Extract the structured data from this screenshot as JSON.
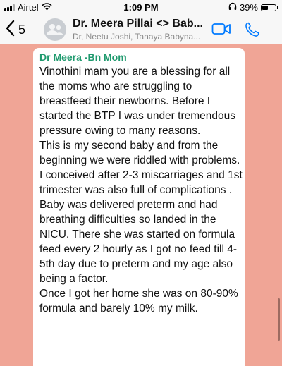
{
  "status": {
    "carrier": "Airtel",
    "time": "1:09 PM",
    "battery": "39%",
    "battery_level": 0.39
  },
  "header": {
    "back_count": "5",
    "title": "Dr. Meera Pillai <> Bab...",
    "subtitle": "Dr, Neetu Joshi, Tanaya Babyna..."
  },
  "message": {
    "sender": "Dr Meera -Bn Mom",
    "text": "Vinothini mam you are a blessing for all the moms who are struggling to breastfeed their newborns. Before I started the BTP I was under tremendous pressure owing to many reasons.\nThis is my second baby and from the beginning we were riddled with problems. I conceived after 2-3 miscarriages and 1st trimester was also full of complications .\nBaby was delivered preterm and had breathing difficulties so landed in the NICU. There she was started on formula feed every 2 hourly as I got no feed till 4-5th day due to preterm and my age also being a factor.\nOnce I got her home she was on 80-90% formula and barely 10% my milk."
  },
  "icons": {
    "signal": "signal-icon",
    "wifi": "wifi-icon",
    "headphones": "headphones-icon",
    "battery": "battery-icon",
    "back": "chevron-left-icon",
    "avatar": "group-avatar-icon",
    "video": "video-call-icon",
    "call": "phone-call-icon"
  },
  "colors": {
    "chat_background": "#f0a596",
    "sender_name": "#1f9a6e",
    "accent": "#007aff"
  }
}
